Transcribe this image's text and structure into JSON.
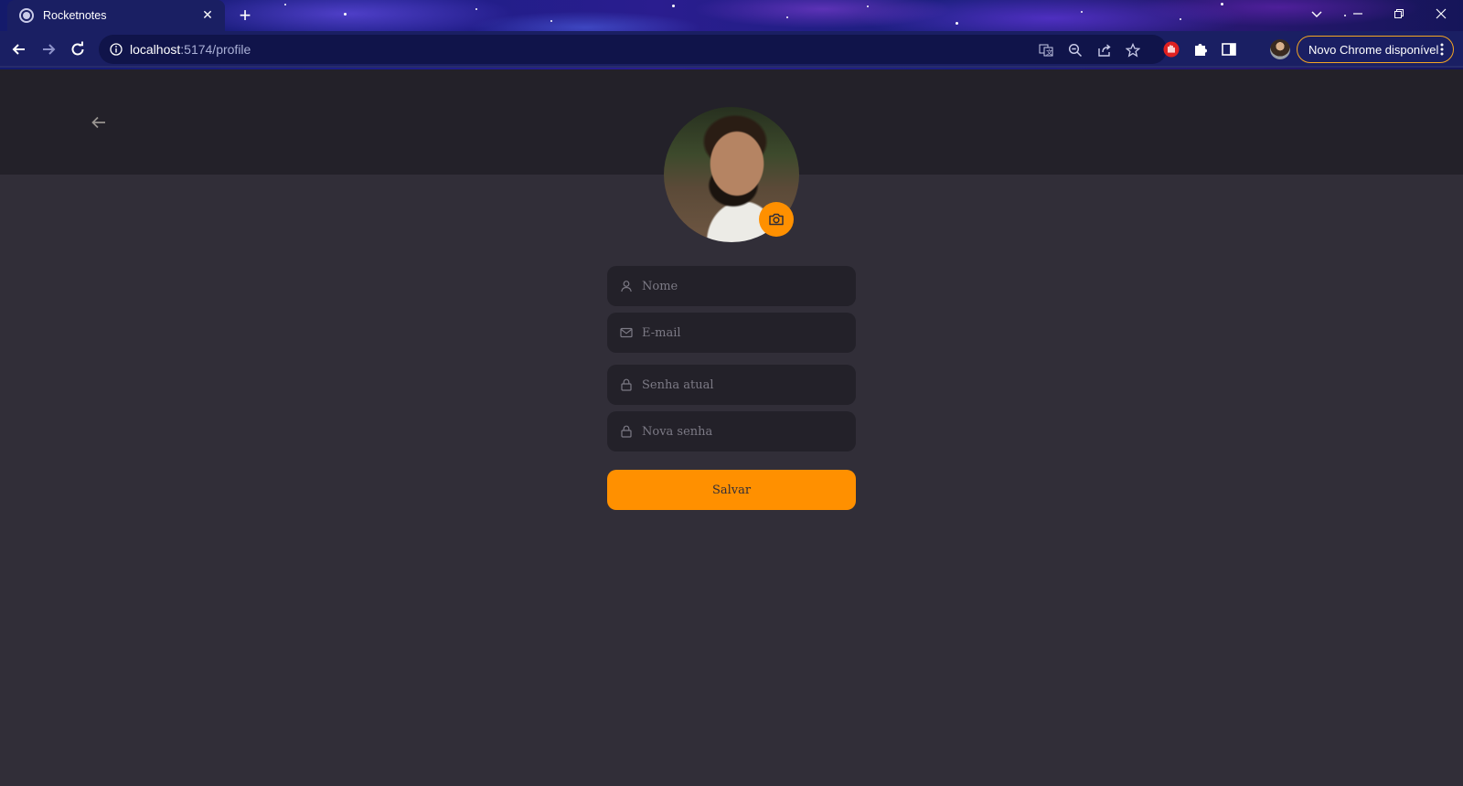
{
  "browser": {
    "tab_title": "Rocketnotes",
    "tab_close": "✕",
    "new_tab": "+",
    "url_host": "localhost",
    "url_path": ":5174/profile",
    "update_label": "Novo Chrome disponível",
    "accent_update": "#f5a623"
  },
  "profile": {
    "fields": [
      {
        "icon": "user-icon",
        "placeholder": "Nome"
      },
      {
        "icon": "mail-icon",
        "placeholder": "E-mail"
      },
      {
        "icon": "lock-icon",
        "placeholder": "Senha atual"
      },
      {
        "icon": "lock-icon",
        "placeholder": "Nova senha"
      }
    ],
    "save_label": "Salvar"
  },
  "colors": {
    "background": "#312e38",
    "header": "#232129",
    "input_bg": "#232129",
    "accent": "#ff9000",
    "placeholder": "#7c7a85"
  }
}
